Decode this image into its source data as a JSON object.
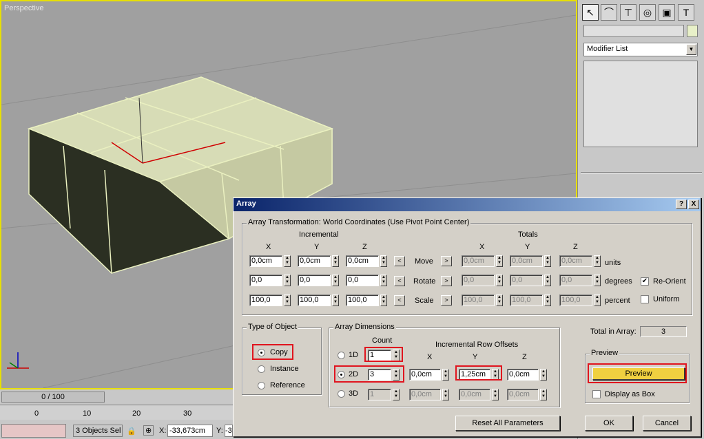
{
  "viewport": {
    "label": "Perspective"
  },
  "command_panel": {
    "tabs": [
      "create-icon",
      "modify-icon",
      "hierarchy-icon",
      "motion-icon",
      "display-icon",
      "utilities-icon"
    ],
    "name_field": "",
    "modifier_list": "Modifier List"
  },
  "timeline": {
    "frame": "0 / 100",
    "ticks": [
      "0",
      "10",
      "20",
      "30"
    ]
  },
  "status": {
    "selection": "3 Objects Sel",
    "x_label": "X:",
    "x_value": "-33,673cm",
    "y_label": "Y:",
    "y_value": "-3"
  },
  "dialog": {
    "title": "Array",
    "help": "?",
    "close": "X",
    "transform_group": "Array Transformation: World Coordinates (Use Pivot Point Center)",
    "incremental": "Incremental",
    "totals": "Totals",
    "axes": [
      "X",
      "Y",
      "Z"
    ],
    "rows": [
      {
        "inc": [
          "0,0cm",
          "0,0cm",
          "0,0cm"
        ],
        "name": "Move",
        "tot": [
          "0,0cm",
          "0,0cm",
          "0,0cm"
        ],
        "unit": "units"
      },
      {
        "inc": [
          "0,0",
          "0,0",
          "0,0"
        ],
        "name": "Rotate",
        "tot": [
          "0,0",
          "0,0",
          "0,0"
        ],
        "unit": "degrees"
      },
      {
        "inc": [
          "100,0",
          "100,0",
          "100,0"
        ],
        "name": "Scale",
        "tot": [
          "100,0",
          "100,0",
          "100,0"
        ],
        "unit": "percent"
      }
    ],
    "reorient": "Re-Orient",
    "uniform": "Uniform",
    "type_group": "Type of Object",
    "copy": "Copy",
    "instance": "Instance",
    "reference": "Reference",
    "dims_group": "Array Dimensions",
    "count": "Count",
    "offsets": "Incremental Row Offsets",
    "d1": {
      "label": "1D",
      "count": "1"
    },
    "d2": {
      "label": "2D",
      "count": "3",
      "x": "0,0cm",
      "y": "1,25cm",
      "z": "0,0cm"
    },
    "d3": {
      "label": "3D",
      "count": "1",
      "x": "0,0cm",
      "y": "0,0cm",
      "z": "0,0cm"
    },
    "total_label": "Total in Array:",
    "total_value": "3",
    "preview_group": "Preview",
    "preview_btn": "Preview",
    "display_box": "Display as Box",
    "reset": "Reset All Parameters",
    "ok": "OK",
    "cancel": "Cancel"
  }
}
